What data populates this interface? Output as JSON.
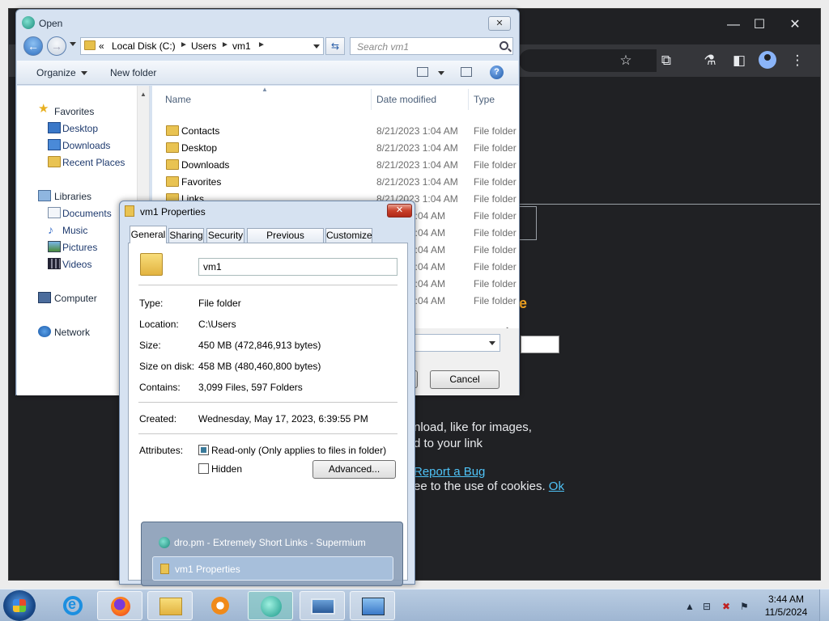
{
  "open_dialog": {
    "title": "Open",
    "breadcrumb": [
      "«",
      "Local Disk (C:)",
      "Users",
      "vm1"
    ],
    "search_placeholder": "Search vm1",
    "organize_label": "Organize",
    "new_folder_label": "New folder",
    "nav_pane": {
      "favorites_label": "Favorites",
      "favorites": [
        "Desktop",
        "Downloads",
        "Recent Places"
      ],
      "libraries_label": "Libraries",
      "libraries": [
        "Documents",
        "Music",
        "Pictures",
        "Videos"
      ],
      "computer_label": "Computer",
      "network_label": "Network"
    },
    "columns": {
      "name": "Name",
      "date": "Date modified",
      "type": "Type"
    },
    "rows": [
      {
        "name": "Contacts",
        "date": "8/21/2023 1:04 AM",
        "type": "File folder"
      },
      {
        "name": "Desktop",
        "date": "8/21/2023 1:04 AM",
        "type": "File folder"
      },
      {
        "name": "Downloads",
        "date": "8/21/2023 1:04 AM",
        "type": "File folder"
      },
      {
        "name": "Favorites",
        "date": "8/21/2023 1:04 AM",
        "type": "File folder"
      },
      {
        "name": "Links",
        "date": "8/21/2023 1:04 AM",
        "type": "File folder"
      },
      {
        "name": "",
        "date": "1:04 AM",
        "type": "File folder"
      },
      {
        "name": "",
        "date": "1:04 AM",
        "type": "File folder"
      },
      {
        "name": "",
        "date": "1:04 AM",
        "type": "File folder"
      },
      {
        "name": "",
        "date": "1:04 AM",
        "type": "File folder"
      },
      {
        "name": "",
        "date": "1:04 AM",
        "type": "File folder"
      },
      {
        "name": "",
        "date": "1:04 AM",
        "type": "File folder"
      }
    ],
    "cancel_label": "Cancel"
  },
  "properties": {
    "title": "vm1 Properties",
    "tabs": [
      "General",
      "Sharing",
      "Security",
      "Previous Versions",
      "Customize"
    ],
    "folder_name": "vm1",
    "fields": [
      {
        "label": "Type:",
        "value": "File folder"
      },
      {
        "label": "Location:",
        "value": "C:\\Users"
      },
      {
        "label": "Size:",
        "value": "450 MB (472,846,913 bytes)"
      },
      {
        "label": "Size on disk:",
        "value": "458 MB (480,460,800 bytes)"
      },
      {
        "label": "Contains:",
        "value": "3,099 Files, 597 Folders"
      }
    ],
    "created_label": "Created:",
    "created_value": "Wednesday, May 17, 2023, 6:39:55 PM",
    "attributes_label": "Attributes:",
    "readonly_label": "Read-only (Only applies to files in folder)",
    "hidden_label": "Hidden",
    "advanced_label": "Advanced..."
  },
  "browser_page": {
    "orange_fragment": "e",
    "line1": "nload, like for images,",
    "line2": "d to your link",
    "report_link": "Report a Bug",
    "cookie_text": "ee to the use of cookies.",
    "ok_link": "Ok"
  },
  "taskbar_popup": {
    "items": [
      "dro.pm - Extremely Short Links - Supermium",
      "vm1 Properties"
    ]
  },
  "clock": {
    "time": "3:44 AM",
    "date": "11/5/2024"
  },
  "colors": {
    "browser_bg": "#202124",
    "link": "#4fc3f7",
    "accent_orange": "#f5a623"
  }
}
